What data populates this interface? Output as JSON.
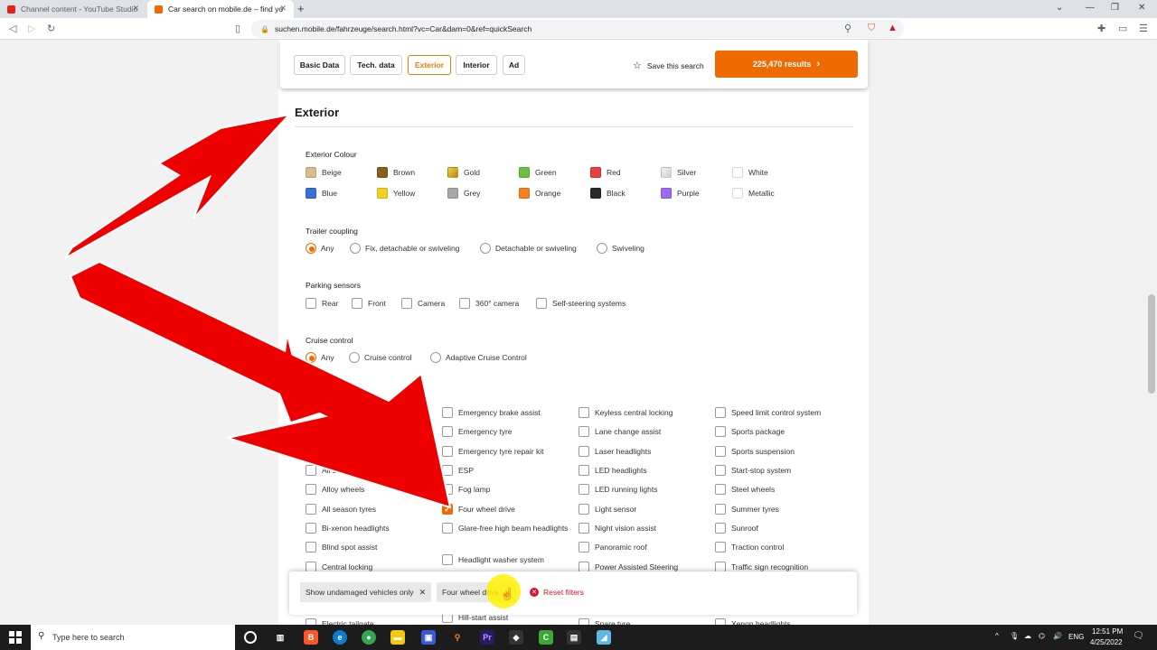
{
  "browser": {
    "tabs": [
      {
        "title": "Channel content - YouTube Studio",
        "active": false
      },
      {
        "title": "Car search on mobile.de – find yo",
        "active": true
      }
    ],
    "url": "suchen.mobile.de/fahrzeuge/search.html?vc=Car&dam=0&ref=quickSearch"
  },
  "filter_tabs": [
    "Basic Data",
    "Tech. data",
    "Exterior",
    "Interior",
    "Ad"
  ],
  "active_filter_tab": "Exterior",
  "save_search_label": "Save this search",
  "results_label": "225,470 results",
  "section_title": "Exterior",
  "exterior_colour": {
    "label": "Exterior Colour",
    "options": [
      {
        "name": "Beige",
        "color": "#d9bc8c"
      },
      {
        "name": "Brown",
        "color": "#8b5e1a"
      },
      {
        "name": "Gold",
        "color": "#d4a017"
      },
      {
        "name": "Green",
        "color": "#6cbf3f"
      },
      {
        "name": "Red",
        "color": "#e83f3f"
      },
      {
        "name": "Silver",
        "color": "#e5e5e5"
      },
      {
        "name": "White",
        "color": "#ffffff"
      },
      {
        "name": "Blue",
        "color": "#3a6fd8"
      },
      {
        "name": "Yellow",
        "color": "#f2d21b"
      },
      {
        "name": "Grey",
        "color": "#a8a8a8"
      },
      {
        "name": "Orange",
        "color": "#f58220"
      },
      {
        "name": "Black",
        "color": "#2a2a2a"
      },
      {
        "name": "Purple",
        "color": "#9b6cf0"
      },
      {
        "name": "Metallic",
        "color": "#ffffff"
      }
    ]
  },
  "trailer_coupling": {
    "label": "Trailer coupling",
    "options": [
      "Any",
      "Fix, detachable or swiveling",
      "Detachable or swiveling",
      "Swiveling"
    ],
    "selected": "Any"
  },
  "parking_sensors": {
    "label": "Parking sensors",
    "options": [
      "Rear",
      "Front",
      "Camera",
      "360° camera",
      "Self-steering systems"
    ]
  },
  "cruise_control": {
    "label": "Cruise control",
    "options": [
      "Any",
      "Cruise control",
      "Adaptive Cruise Control"
    ],
    "selected": "Any"
  },
  "features": {
    "col1": [
      "ering lights",
      "All se",
      "Alloy wheels",
      "All season tyres",
      "Bi-xenon headlights",
      "Blind spot assist",
      "Central locking",
      "Electric tailgate"
    ],
    "col2": [
      "Emergency brake assist",
      "Emergency tyre",
      "Emergency tyre repair kit",
      "ESP",
      "Fog lamp",
      "Four wheel drive",
      "Glare-free high beam headlights",
      "Headlight washer system",
      "Hill-start assist"
    ],
    "col3": [
      "Keyless central locking",
      "Lane change assist",
      "Laser headlights",
      "LED headlights",
      "LED running lights",
      "Light sensor",
      "Night vision assist",
      "Panoramic roof",
      "Power Assisted Steering",
      "Spare tyre"
    ],
    "col4": [
      "Speed limit control system",
      "Sports package",
      "Sports suspension",
      "Start-stop system",
      "Steel wheels",
      "Summer tyres",
      "Sunroof",
      "Traction control",
      "Traffic sign recognition",
      "Xenon headlights"
    ],
    "checked": [
      "Four wheel drive"
    ]
  },
  "active_filters": [
    "Show undamaged vehicles only",
    "Four wheel drive"
  ],
  "reset_filters_label": "Reset filters",
  "taskbar": {
    "search_placeholder": "Type here to search",
    "lang": "ENG",
    "time": "12:51 PM",
    "date": "4/25/2022"
  }
}
